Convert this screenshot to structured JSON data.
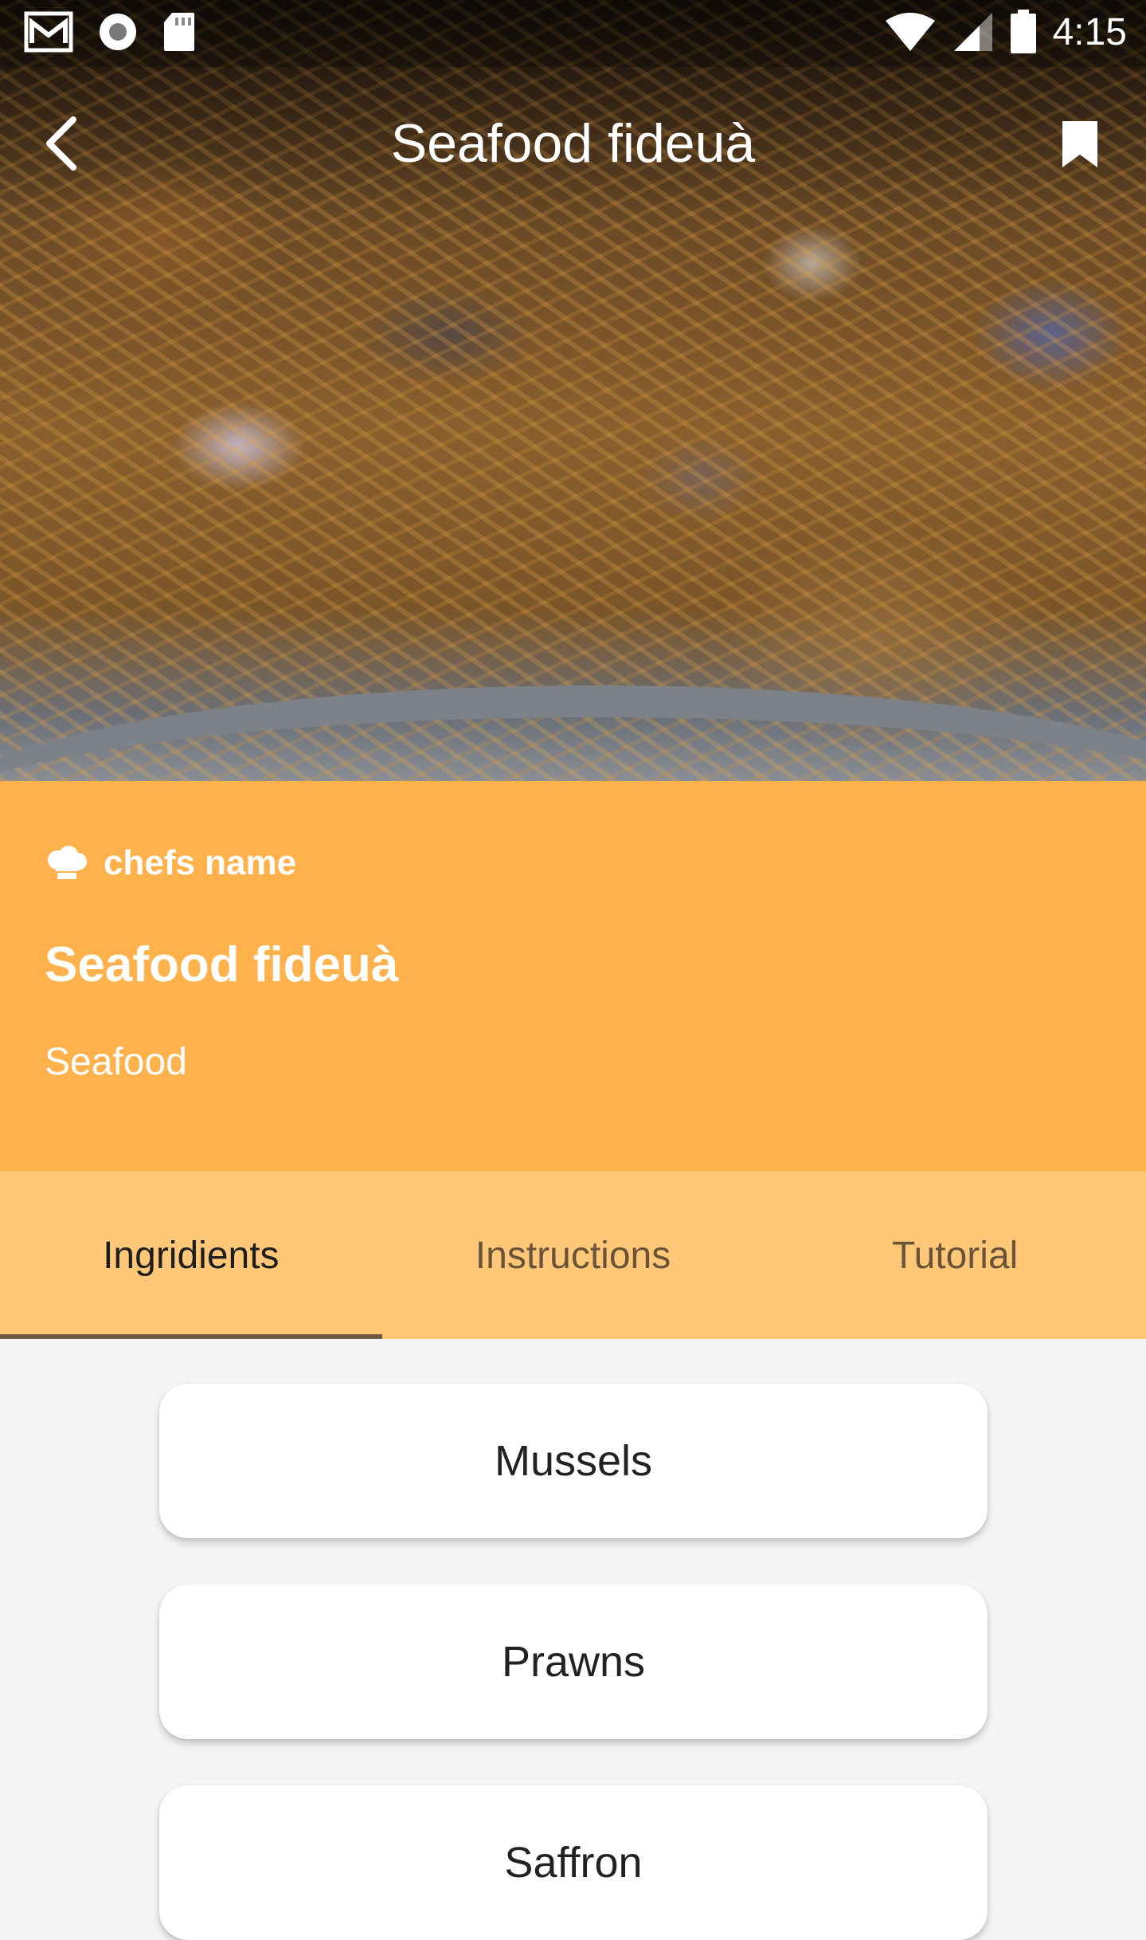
{
  "status_bar": {
    "time": "4:15",
    "icons": [
      "gmail-icon",
      "record-icon",
      "sd-card-icon",
      "wifi-icon",
      "signal-icon",
      "battery-icon"
    ]
  },
  "app_bar": {
    "title": "Seafood fideuà",
    "back_icon": "back-arrow-icon",
    "bookmark_icon": "bookmark-icon"
  },
  "recipe": {
    "chef_name": "chefs name",
    "title": "Seafood fideuà",
    "category": "Seafood"
  },
  "tabs": [
    {
      "label": "Ingridients",
      "active": true
    },
    {
      "label": "Instructions",
      "active": false
    },
    {
      "label": "Tutorial",
      "active": false
    }
  ],
  "ingredients": [
    "Mussels",
    "Prawns",
    "Saffron"
  ],
  "colors": {
    "accent": "#ffb24c",
    "tab_bar": "#ffc878",
    "tab_indicator": "#6d5a44",
    "background": "#f5f5f5"
  }
}
